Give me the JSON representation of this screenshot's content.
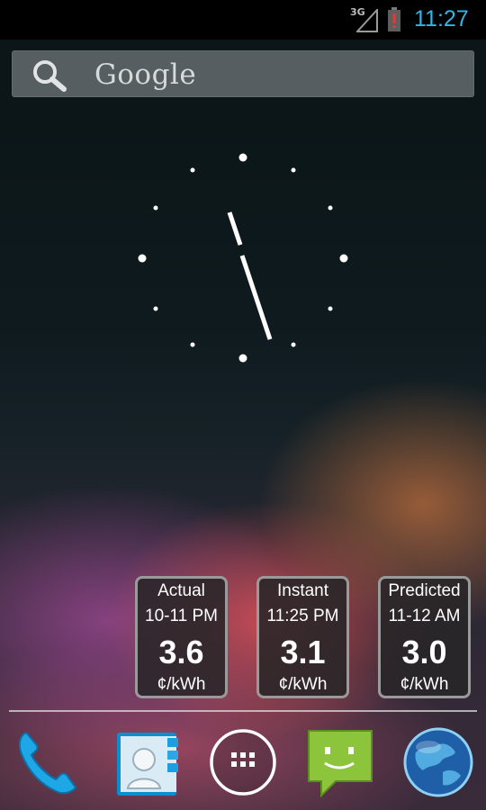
{
  "status_bar": {
    "network": "3G",
    "time": "11:27",
    "signal_icon": "signal-icon",
    "battery_icon": "battery-alert-icon",
    "time_color": "#33b5e5"
  },
  "search": {
    "label": "Google",
    "icon": "search-icon"
  },
  "clock": {
    "type": "analog-clock",
    "hour": 11,
    "minute": 27
  },
  "price_widgets": [
    {
      "title": "Actual",
      "time": "10-11 PM",
      "value": "3.6",
      "unit": "¢/kWh"
    },
    {
      "title": "Instant",
      "time": "11:25 PM",
      "value": "3.1",
      "unit": "¢/kWh"
    },
    {
      "title": "Predicted",
      "time": "11-12 AM",
      "value": "3.0",
      "unit": "¢/kWh"
    }
  ],
  "dock": [
    {
      "name": "phone-icon"
    },
    {
      "name": "contacts-icon"
    },
    {
      "name": "app-drawer-icon"
    },
    {
      "name": "messaging-icon"
    },
    {
      "name": "browser-globe-icon"
    }
  ]
}
